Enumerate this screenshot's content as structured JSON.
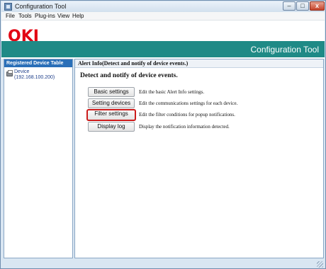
{
  "window": {
    "title": "Configuration Tool",
    "controls": {
      "minimize": "–",
      "maximize": "□",
      "close": "x"
    }
  },
  "menu": [
    "File",
    "Tools",
    "Plug-ins",
    "View",
    "Help"
  ],
  "brand": {
    "logo": "OKI",
    "app_title": "Configuration Tool",
    "logo_color": "#e20613",
    "accent_color": "#1f8a86"
  },
  "left_panel": {
    "header": "Registered Device Table",
    "devices": [
      {
        "name": "Device",
        "address": "(192.168.100.200)",
        "icon": "printer-icon"
      }
    ]
  },
  "main": {
    "header": "Alert Info(Detect and notify of device events.)",
    "section_title": "Detect and notify of device events.",
    "actions": [
      {
        "label": "Basic settings",
        "description": "Edit the basic Alert Info settings."
      },
      {
        "label": "Setting devices",
        "description": "Edit the communications settings for each device."
      },
      {
        "label": "Filter settings",
        "description": "Edit the filter conditions for popup notifications.",
        "highlighted": true
      },
      {
        "label": "Display log",
        "description": "Display the notification information detected."
      }
    ]
  }
}
